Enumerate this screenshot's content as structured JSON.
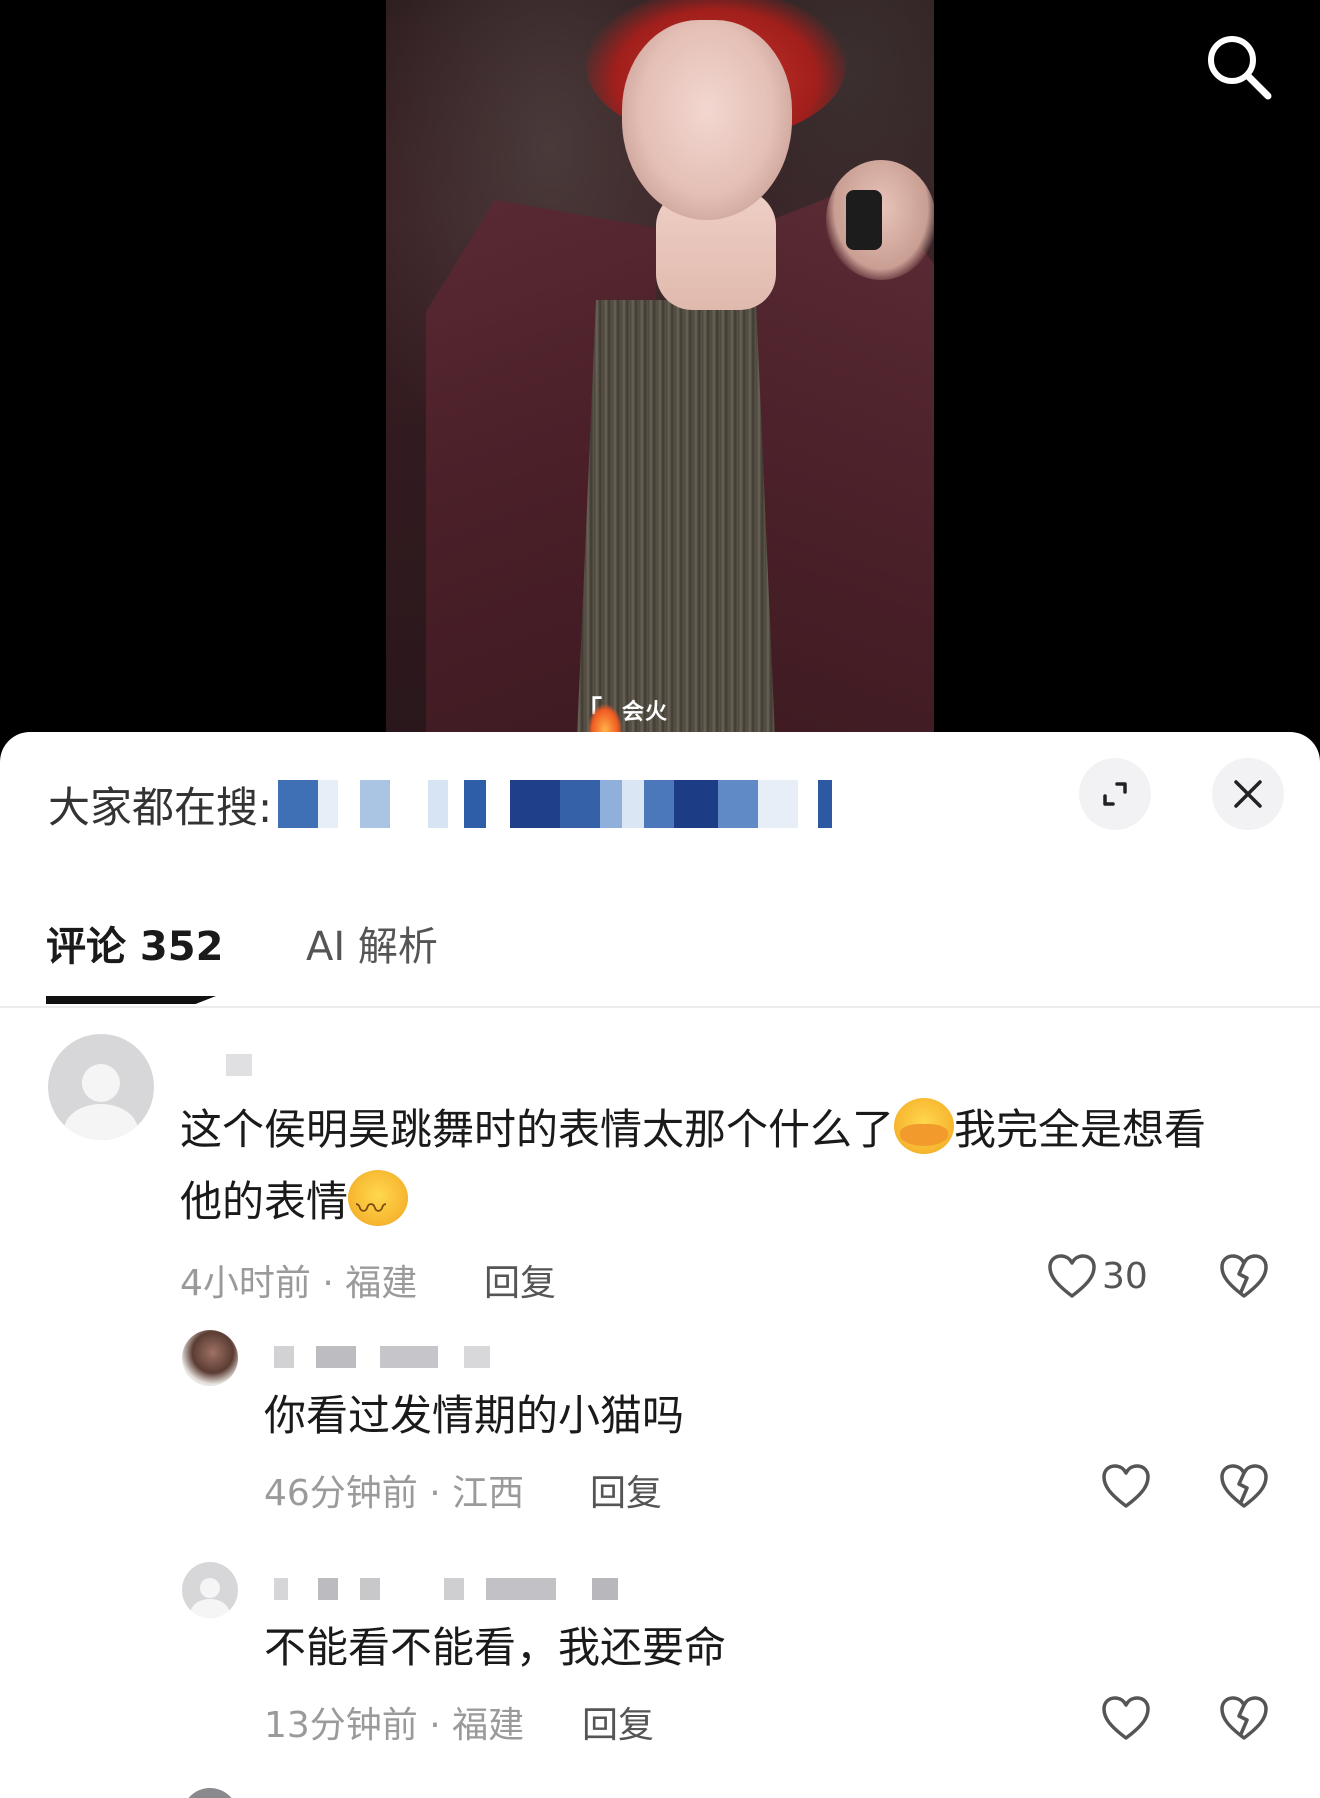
{
  "sheet": {
    "hot_search_label": "大家都在搜:",
    "expand_icon": "expand-icon",
    "close_icon": "close-icon"
  },
  "tabs": [
    {
      "label": "评论 352",
      "active": true
    },
    {
      "label": "AI 解析",
      "active": false
    }
  ],
  "video": {
    "overlay_logo_text": "会火",
    "search_icon": "search-icon"
  },
  "comments": [
    {
      "text_part1": "这个侯明昊跳舞时的表情太那个什么了",
      "emoji1": "covering-mouth-emoji",
      "text_part2": "我完全是想看",
      "text_line2": "他的表情",
      "emoji2": "smug-emoji",
      "time_location": "4小时前 · 福建",
      "reply_label": "回复",
      "likes": "30"
    },
    {
      "text": "你看过发情期的小猫吗",
      "time_location": "46分钟前 · 江西",
      "reply_label": "回复"
    },
    {
      "text": "不能看不能看，我还要命",
      "time_location": "13分钟前 · 福建",
      "reply_label": "回复"
    }
  ],
  "colors": {
    "accent": "#111111",
    "meta_text": "#9a9a9a",
    "tab_indicator": "#111111"
  }
}
